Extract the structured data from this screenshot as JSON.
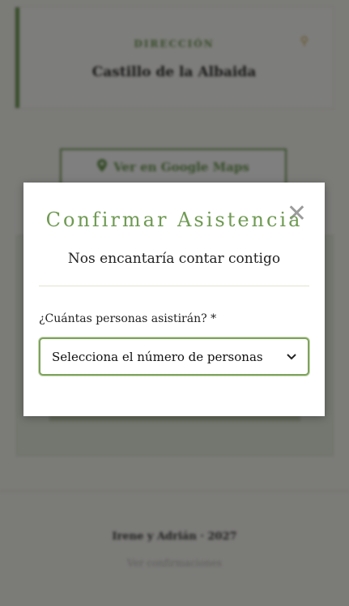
{
  "location_card": {
    "label": "DIRECCIÓN",
    "venue": "Castillo de la Albaida",
    "pin_icon": "map-pin-icon"
  },
  "maps_button": {
    "label": "Ver en Google Maps",
    "icon": "map-marker-icon"
  },
  "footer": {
    "names": "Irene y Adrián · 2027",
    "link": "Ver confirmaciones"
  },
  "modal": {
    "title": "Confirmar Asistencia",
    "subtitle": "Nos encantaría contar contigo",
    "close_icon": "close-icon",
    "guests_label": "¿Cuántas personas asistirán? *",
    "guests_select": {
      "selected": "Selecciona el número de personas"
    }
  },
  "colors": {
    "accent": "#6f9a53",
    "gold": "#c9a84c",
    "overlay": "rgba(0,0,0,0.5)"
  }
}
